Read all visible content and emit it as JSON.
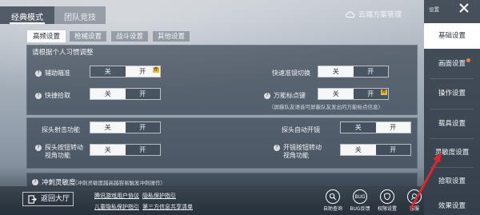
{
  "mode_tabs": [
    {
      "label": "经典模式",
      "active": true
    },
    {
      "label": "团队竞技",
      "active": false
    }
  ],
  "cloud_button": {
    "label": "云端方案管理",
    "icon": "cloud-icon"
  },
  "sub_tabs": [
    {
      "label": "高频设置",
      "active": true
    },
    {
      "label": "枪械设置",
      "active": false
    },
    {
      "label": "战斗设置",
      "active": false
    },
    {
      "label": "其他设置",
      "active": false
    }
  ],
  "panel_title": "请根据个人习惯调整",
  "toggle_labels": {
    "off": "关",
    "on": "开"
  },
  "settings": {
    "aim_assist": {
      "label": "辅助瞄准",
      "value": "on",
      "badge": "荐"
    },
    "quick_peek_scope": {
      "label": "快速准镜切换",
      "value": "off"
    },
    "quick_pickup": {
      "label": "快捷拾取",
      "value": "off"
    },
    "universal_mark": {
      "label": "万能标点键",
      "value": "off",
      "badge": "荐"
    },
    "universal_mark_note": "（屏蔽队友语音可屏蔽队友发出的万能标点信息）",
    "peek_fire": {
      "label": "探头射击功能",
      "value": "off"
    },
    "peek_auto_scope": {
      "label": "探头自动开镜",
      "value": "on"
    },
    "peek_rotate_view": {
      "label_line1": "探头按钮转动",
      "label_line2": "视角功能",
      "value": "off"
    },
    "fire_rotate_view": {
      "label_line1": "开镜按钮转动",
      "label_line2": "视角功能",
      "value": "off"
    }
  },
  "sensitivity": {
    "title": "冲刺灵敏度",
    "note": "（冲刺灵敏度越高越容易触发冲刺操作）"
  },
  "bottom": {
    "back_button": "返回大厅",
    "links": [
      "腾讯游戏用户协议",
      "隐私保护指引",
      "儿童隐私保护指引",
      "第三方信息共享清单"
    ],
    "tools": [
      {
        "label": "自助查询",
        "icon": "search-icon"
      },
      {
        "label": "BUG反馈",
        "icon": "bug-icon",
        "text": "BUG"
      },
      {
        "label": "权限设置",
        "icon": "permission-icon"
      },
      {
        "label": "客服",
        "icon": "customer-service-icon"
      }
    ]
  },
  "sidebar": {
    "header": "设置",
    "items": [
      {
        "label": "基础设置",
        "active": true,
        "dot": false
      },
      {
        "label": "画面设置",
        "active": false,
        "dot": true
      },
      {
        "label": "操作设置",
        "active": false,
        "dot": false
      },
      {
        "label": "载具设置",
        "active": false,
        "dot": false
      },
      {
        "label": "灵敏度设置",
        "active": false,
        "dot": false
      },
      {
        "label": "拾取设置",
        "active": false,
        "dot": false
      },
      {
        "label": "效果设置",
        "active": false,
        "dot": false
      }
    ]
  },
  "colors": {
    "accent_badge": "#e4b938",
    "notification_dot": "#f07f2e",
    "annotation_arrow": "#e0262a"
  }
}
